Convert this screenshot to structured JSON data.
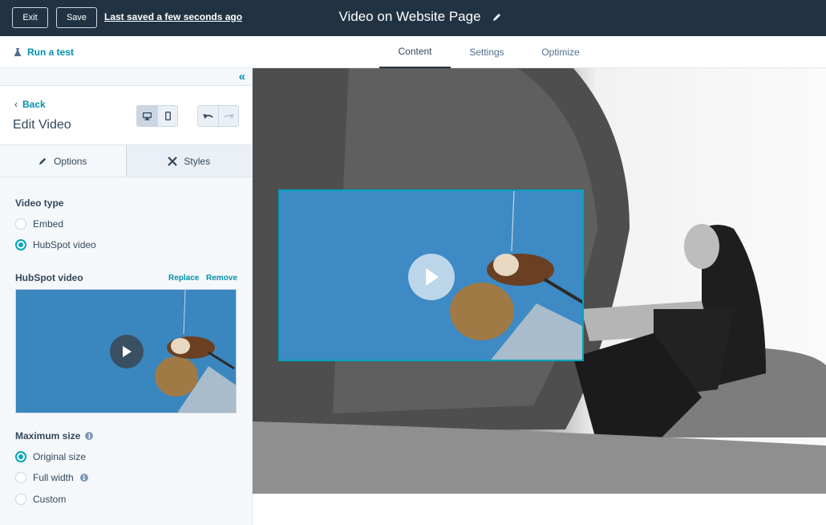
{
  "topbar": {
    "exit_label": "Exit",
    "save_label": "Save",
    "last_saved": "Last saved a few seconds ago",
    "page_title": "Video on Website Page",
    "edit_title_icon": "pencil-icon"
  },
  "navbar": {
    "run_test_label": "Run a test",
    "run_test_icon": "flask-icon",
    "tabs": [
      {
        "label": "Content",
        "active": true
      },
      {
        "label": "Settings",
        "active": false
      },
      {
        "label": "Optimize",
        "active": false
      }
    ]
  },
  "sidebar": {
    "collapse_icon": "double-chevron-left-icon",
    "back_label": "Back",
    "title": "Edit Video",
    "device_buttons": [
      {
        "icon": "desktop-icon",
        "active": true
      },
      {
        "icon": "mobile-icon",
        "active": false
      }
    ],
    "history_buttons": [
      {
        "icon": "undo-icon",
        "enabled": true
      },
      {
        "icon": "redo-icon",
        "enabled": false
      }
    ],
    "sub_tabs": [
      {
        "label": "Options",
        "icon": "pencil-icon",
        "active": true
      },
      {
        "label": "Styles",
        "icon": "brush-icon",
        "active": false
      }
    ],
    "video_type": {
      "label": "Video type",
      "options": [
        {
          "label": "Embed",
          "checked": false
        },
        {
          "label": "HubSpot video",
          "checked": true
        }
      ]
    },
    "hubspot_video": {
      "label": "HubSpot video",
      "replace_label": "Replace",
      "remove_label": "Remove"
    },
    "maximum_size": {
      "label": "Maximum size",
      "options": [
        {
          "label": "Original size",
          "checked": true,
          "info": false
        },
        {
          "label": "Full width",
          "checked": false,
          "info": true
        },
        {
          "label": "Custom",
          "checked": false,
          "info": false
        }
      ]
    }
  },
  "colors": {
    "topbar_bg": "#213343",
    "accent": "#00a4bd",
    "link": "#0091ae",
    "text": "#33475b"
  }
}
